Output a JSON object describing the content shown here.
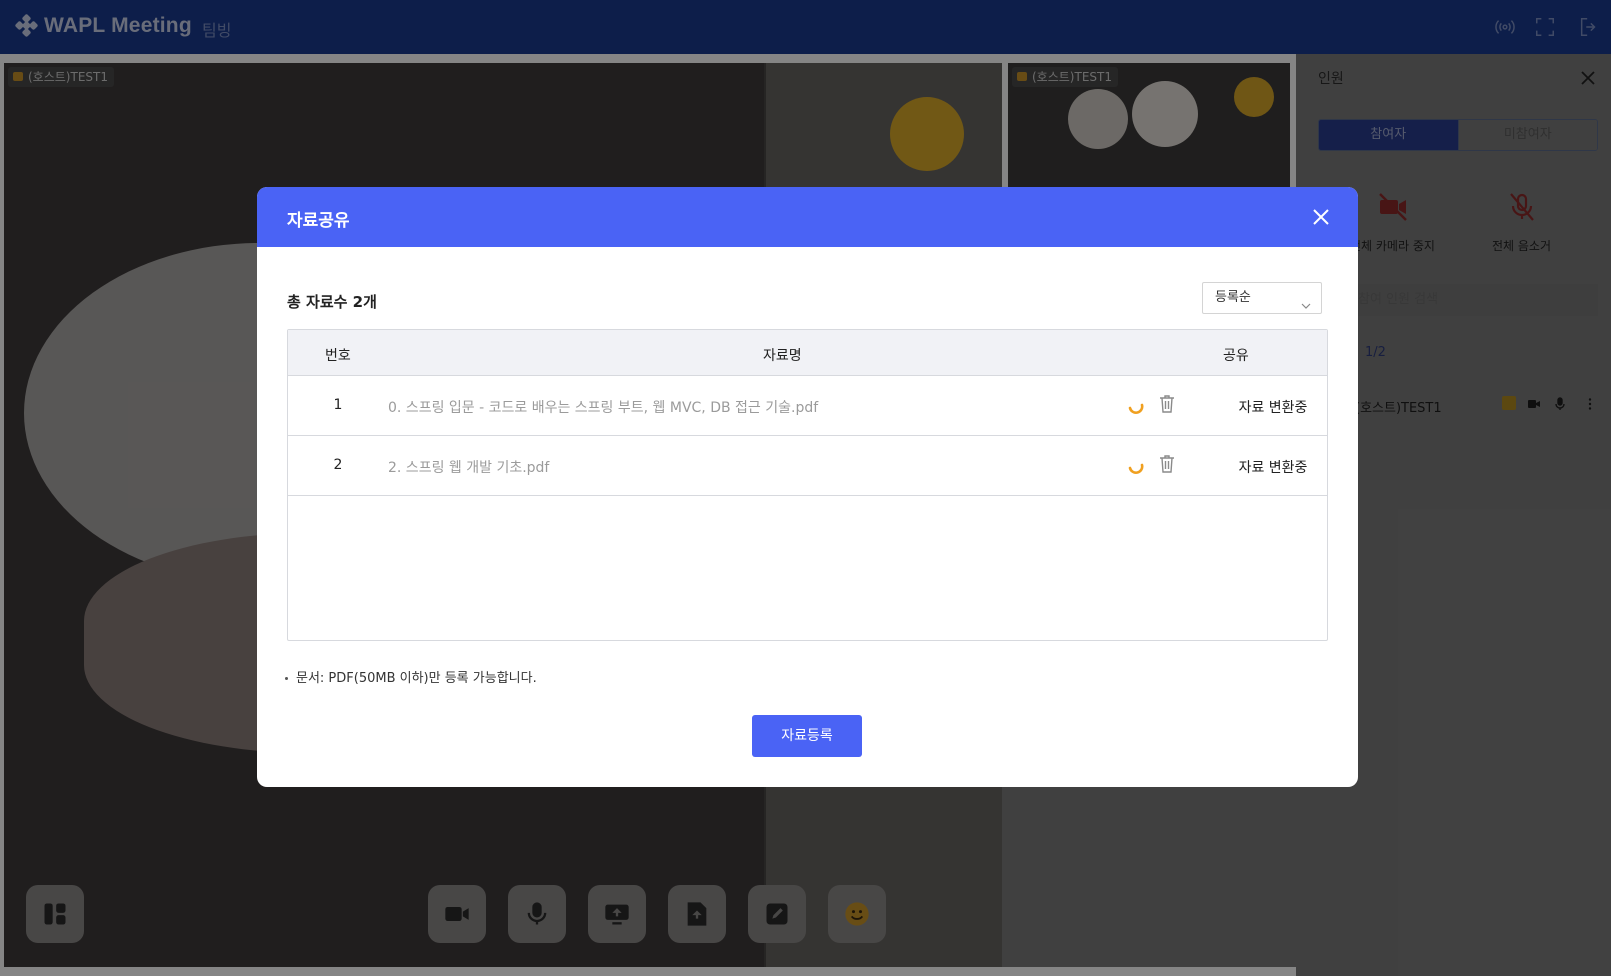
{
  "app": {
    "logo_text": "WAPL Meeting",
    "room_name": "팀빙"
  },
  "top_icons": [
    "broadcast-icon",
    "fullscreen-icon",
    "exit-icon"
  ],
  "videos": {
    "main_tag": "(호스트)TEST1",
    "side_tag": "(호스트)TEST1"
  },
  "controls": [
    "layout-icon",
    "camera-icon",
    "microphone-icon",
    "screen-share-icon",
    "file-upload-icon",
    "draw-icon",
    "emoji-icon"
  ],
  "panel": {
    "title": "인원",
    "tabs": [
      {
        "label": "참여자",
        "active": true
      },
      {
        "label": "미참여자",
        "active": false
      }
    ],
    "bulk_actions": [
      {
        "label": "전체 카메라 중지",
        "icon": "camera-off-icon"
      },
      {
        "label": "전체 음소거",
        "icon": "mic-off-icon"
      }
    ],
    "search_placeholder": "참여 인원 검색",
    "count": "1/2",
    "participant_name": "(호스트)TEST1"
  },
  "modal": {
    "title": "자료공유",
    "total_label": "총 자료수 2개",
    "sort_selected": "등록순",
    "columns": {
      "number": "번호",
      "name": "자료명",
      "share": "공유"
    },
    "rows": [
      {
        "number": "1",
        "name": "0. 스프링 입문 - 코드로 배우는 스프링 부트, 웹 MVC, DB 접근 기술.pdf",
        "share": "자료 변환중"
      },
      {
        "number": "2",
        "name": "2. 스프링 웹 개발 기초.pdf",
        "share": "자료 변환중"
      }
    ],
    "notice": "문서: PDF(50MB 이하)만 등록 가능합니다.",
    "submit_label": "자료등록"
  },
  "colors": {
    "topbar": "#1a3a8f",
    "accent": "#4a63f5",
    "spinner": "#f0a020"
  }
}
